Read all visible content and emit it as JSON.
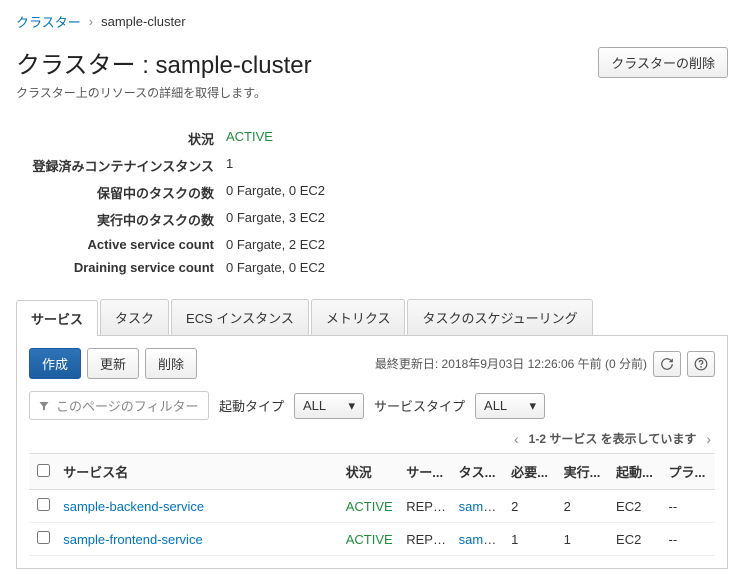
{
  "breadcrumb": {
    "root": "クラスター",
    "current": "sample-cluster"
  },
  "header": {
    "title": "クラスター : sample-cluster",
    "delete_button": "クラスターの削除"
  },
  "subtitle": "クラスター上のリソースの詳細を取得します。",
  "info": {
    "rows": [
      {
        "label": "状況",
        "value": "ACTIVE",
        "status": true
      },
      {
        "label": "登録済みコンテナインスタンス",
        "value": "1"
      },
      {
        "label": "保留中のタスクの数",
        "value": "0 Fargate, 0 EC2"
      },
      {
        "label": "実行中のタスクの数",
        "value": "0 Fargate, 3 EC2"
      },
      {
        "label": "Active service count",
        "value": "0 Fargate, 2 EC2"
      },
      {
        "label": "Draining service count",
        "value": "0 Fargate, 0 EC2"
      }
    ]
  },
  "tabs": [
    {
      "label": "サービス",
      "active": true
    },
    {
      "label": "タスク"
    },
    {
      "label": "ECS インスタンス"
    },
    {
      "label": "メトリクス"
    },
    {
      "label": "タスクのスケジューリング"
    }
  ],
  "toolbar": {
    "create": "作成",
    "update": "更新",
    "delete": "削除",
    "last_updated": "最終更新日: 2018年9月03日 12:26:06 午前 (0 分前)"
  },
  "filter": {
    "placeholder": "このページのフィルター",
    "launch_type_label": "起動タイプ",
    "launch_type_value": "ALL",
    "service_type_label": "サービスタイプ",
    "service_type_value": "ALL"
  },
  "pager": {
    "text": "1-2 サービス を表示しています"
  },
  "table": {
    "headers": [
      "サービス名",
      "状況",
      "サー...",
      "タス...",
      "必要...",
      "実行...",
      "起動...",
      "プラ..."
    ],
    "rows": [
      {
        "name": "sample-backend-service",
        "status": "ACTIVE",
        "service_type": "REPLI...",
        "task_def": "sampl...",
        "desired": "2",
        "running": "2",
        "launch": "EC2",
        "platform": "--"
      },
      {
        "name": "sample-frontend-service",
        "status": "ACTIVE",
        "service_type": "REPLI...",
        "task_def": "sampl...",
        "desired": "1",
        "running": "1",
        "launch": "EC2",
        "platform": "--"
      }
    ]
  }
}
